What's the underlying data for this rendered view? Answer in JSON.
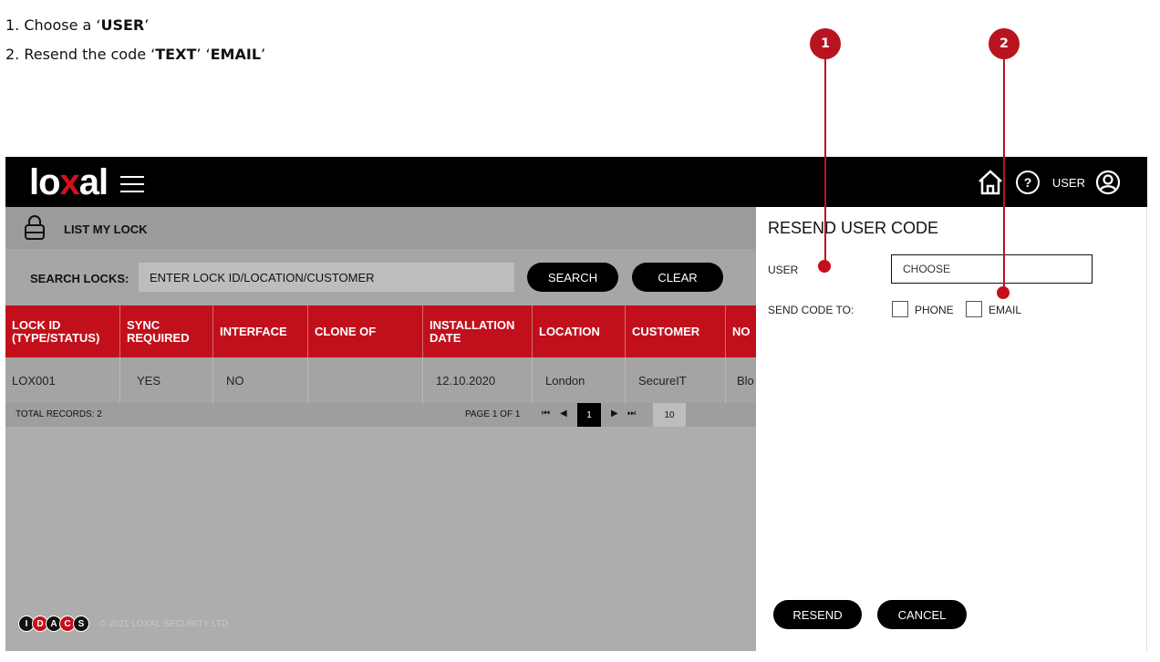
{
  "instructions": {
    "line1_prefix": "1. Choose a ‘",
    "line1_bold": "USER",
    "line1_suffix": "’",
    "line2_prefix": "2. Resend the code ‘",
    "line2_bold1": "TEXT",
    "line2_mid": "’ ‘",
    "line2_bold2": "EMAIL",
    "line2_suffix": "’"
  },
  "callouts": [
    "1",
    "2"
  ],
  "header": {
    "logo_prefix": "lo",
    "logo_x": "x",
    "logo_suffix": "al",
    "user_label": "USER",
    "help_symbol": "?",
    "icons": [
      "menu-icon",
      "home-icon",
      "help-icon",
      "user-icon"
    ]
  },
  "list": {
    "title": "LIST MY LOCK",
    "search_label": "SEARCH LOCKS:",
    "search_placeholder": "ENTER LOCK ID/LOCATION/CUSTOMER",
    "search_button": "SEARCH",
    "clear_button": "CLEAR"
  },
  "table": {
    "columns": [
      "LOCK ID (TYPE/STATUS)",
      "SYNC REQUIRED",
      "INTERFACE",
      "CLONE OF",
      "INSTALLATION DATE",
      "LOCATION",
      "CUSTOMER",
      "NO"
    ],
    "rows": [
      [
        "LOX001",
        "YES",
        "NO",
        "",
        "12.10.2020",
        "London",
        "SecureIT",
        "Blo"
      ]
    ]
  },
  "pager": {
    "total": "TOTAL RECORDS: 2",
    "page_of": "PAGE 1 OF 1",
    "first": "⏮",
    "prev": "◀",
    "current": "1",
    "next": "▶",
    "last": "⏭",
    "page_size": "10"
  },
  "footer": {
    "logo_letters": [
      "I",
      "D",
      "A",
      "C",
      "S"
    ],
    "copyright": "© 2021 LOXAL SECURITY LTD"
  },
  "panel": {
    "title": "RESEND USER CODE",
    "user_label": "USER",
    "user_placeholder": "CHOOSE",
    "send_to_label": "SEND CODE TO:",
    "phone_label": "PHONE",
    "email_label": "EMAIL",
    "resend_button": "RESEND",
    "cancel_button": "CANCEL"
  },
  "colors": {
    "brand_red": "#c1101c",
    "topbar": "#000000",
    "callout": "#b8141f"
  }
}
